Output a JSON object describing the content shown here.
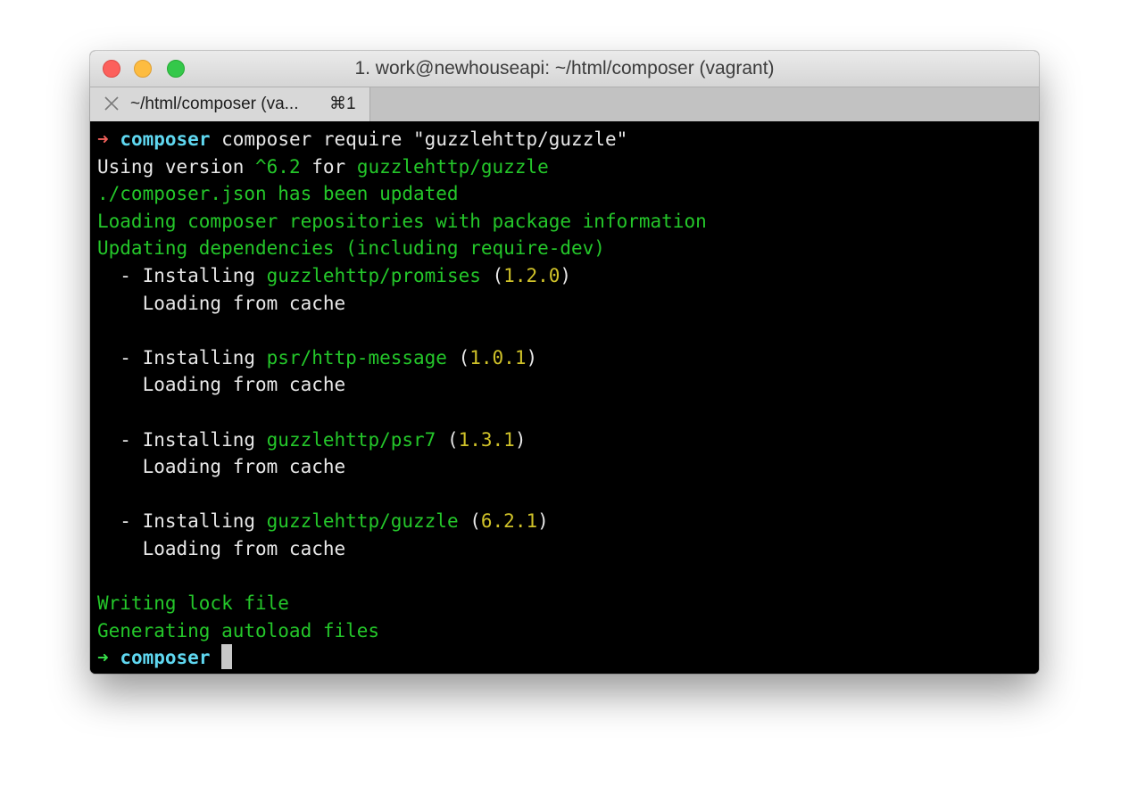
{
  "window": {
    "title": "1. work@newhouseapi: ~/html/composer (vagrant)"
  },
  "tab": {
    "label": "~/html/composer (va...",
    "shortcut": "⌘1"
  },
  "prompt": {
    "arrow": "➜",
    "directory": "composer",
    "command": " composer require \"guzzlehttp/guzzle\""
  },
  "output": {
    "using_prefix": "Using version ",
    "using_version": "^6.2",
    "using_for": " for ",
    "using_package": "guzzlehttp/guzzle",
    "json_updated": "./composer.json has been updated",
    "loading_repos": "Loading composer repositories with package information",
    "updating": "Updating dependencies (including require-dev)",
    "installs": [
      {
        "prefix": "  - Installing ",
        "package": "guzzlehttp/promises",
        "open": " (",
        "version": "1.2.0",
        "close": ")",
        "sub": "    Loading from cache"
      },
      {
        "prefix": "  - Installing ",
        "package": "psr/http-message",
        "open": " (",
        "version": "1.0.1",
        "close": ")",
        "sub": "    Loading from cache"
      },
      {
        "prefix": "  - Installing ",
        "package": "guzzlehttp/psr7",
        "open": " (",
        "version": "1.3.1",
        "close": ")",
        "sub": "    Loading from cache"
      },
      {
        "prefix": "  - Installing ",
        "package": "guzzlehttp/guzzle",
        "open": " (",
        "version": "6.2.1",
        "close": ")",
        "sub": "    Loading from cache"
      }
    ],
    "writing_lock": "Writing lock file",
    "generating": "Generating autoload files"
  },
  "final_prompt": {
    "arrow": "➜",
    "directory": "composer"
  },
  "colors": {
    "close_red": "#fc605c",
    "minimize_yellow": "#fdbc40",
    "zoom_green": "#34c84a",
    "terminal_bg": "#000000",
    "output_green": "#24c72a",
    "version_yellow": "#d0c229",
    "prompt_cyan": "#5fd7f0",
    "error_arrow_red": "#f1605a",
    "success_arrow_green": "#37e04a"
  }
}
